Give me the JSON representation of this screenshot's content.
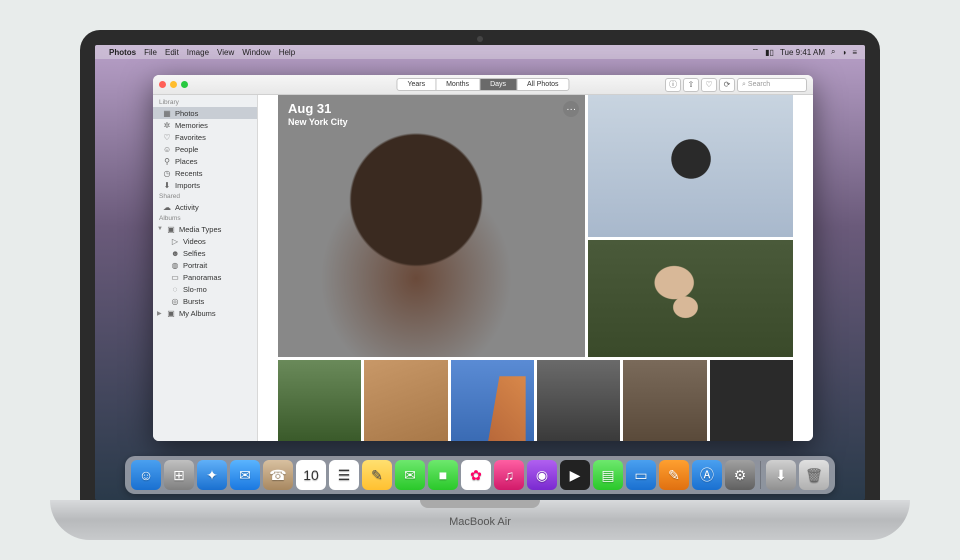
{
  "menubar": {
    "app": "Photos",
    "items": [
      "File",
      "Edit",
      "Image",
      "View",
      "Window",
      "Help"
    ],
    "clock": "Tue 9:41 AM"
  },
  "hardware_label": "MacBook Air",
  "toolbar": {
    "segments": [
      "Years",
      "Months",
      "Days",
      "All Photos"
    ],
    "active_segment": "Days",
    "search_placeholder": "Search"
  },
  "sidebar": {
    "library_header": "Library",
    "library": [
      {
        "icon": "photos-icon",
        "label": "Photos",
        "selected": true
      },
      {
        "icon": "memories-icon",
        "label": "Memories"
      },
      {
        "icon": "heart-icon",
        "label": "Favorites"
      },
      {
        "icon": "person-icon",
        "label": "People"
      },
      {
        "icon": "pin-icon",
        "label": "Places"
      },
      {
        "icon": "clock-icon",
        "label": "Recents"
      },
      {
        "icon": "import-icon",
        "label": "Imports"
      }
    ],
    "shared_header": "Shared",
    "shared": [
      {
        "icon": "cloud-icon",
        "label": "Activity"
      }
    ],
    "albums_header": "Albums",
    "albums_groups": [
      {
        "icon": "folder-icon",
        "label": "Media Types",
        "expanded": true,
        "children": [
          {
            "icon": "video-icon",
            "label": "Videos"
          },
          {
            "icon": "selfie-icon",
            "label": "Selfies"
          },
          {
            "icon": "portrait-icon",
            "label": "Portrait"
          },
          {
            "icon": "panorama-icon",
            "label": "Panoramas"
          },
          {
            "icon": "slomo-icon",
            "label": "Slo-mo"
          },
          {
            "icon": "burst-icon",
            "label": "Bursts"
          }
        ]
      },
      {
        "icon": "folder-icon",
        "label": "My Albums",
        "expanded": false
      }
    ]
  },
  "hero": {
    "date": "Aug 31",
    "location": "New York City",
    "more_label": "···"
  },
  "dock": [
    {
      "name": "finder",
      "bg": "linear-gradient(#4aa0f0,#1a70d0)",
      "glyph": "☺"
    },
    {
      "name": "launchpad",
      "bg": "linear-gradient(#c0c0c0,#808080)",
      "glyph": "⊞"
    },
    {
      "name": "safari",
      "bg": "linear-gradient(#60b0f8,#1a70d0)",
      "glyph": "✦"
    },
    {
      "name": "mail",
      "bg": "linear-gradient(#5ab4ff,#1a78e0)",
      "glyph": "✉"
    },
    {
      "name": "contacts",
      "bg": "linear-gradient(#d8c0a0,#a88860)",
      "glyph": "☎"
    },
    {
      "name": "calendar",
      "bg": "#fff",
      "glyph": "10",
      "color": "#333"
    },
    {
      "name": "reminders",
      "bg": "#fff",
      "glyph": "☰",
      "color": "#333"
    },
    {
      "name": "notes",
      "bg": "linear-gradient(#ffe070,#ffc030)",
      "glyph": "✎",
      "color": "#555"
    },
    {
      "name": "messages",
      "bg": "linear-gradient(#6de86d,#2ac82a)",
      "glyph": "✉"
    },
    {
      "name": "facetime",
      "bg": "linear-gradient(#6de86d,#2ac82a)",
      "glyph": "■"
    },
    {
      "name": "photos",
      "bg": "#fff",
      "glyph": "✿",
      "color": "#f06"
    },
    {
      "name": "music",
      "bg": "linear-gradient(#ff5fa2,#d11a6a)",
      "glyph": "♫"
    },
    {
      "name": "podcasts",
      "bg": "linear-gradient(#b060f0,#7a2ad0)",
      "glyph": "◉"
    },
    {
      "name": "tv",
      "bg": "#222",
      "glyph": "▶"
    },
    {
      "name": "numbers",
      "bg": "linear-gradient(#6de86d,#2ac82a)",
      "glyph": "▤"
    },
    {
      "name": "keynote",
      "bg": "linear-gradient(#4aa0f0,#1a70d0)",
      "glyph": "▭"
    },
    {
      "name": "pages",
      "bg": "linear-gradient(#ffa030,#e07010)",
      "glyph": "✎"
    },
    {
      "name": "appstore",
      "bg": "linear-gradient(#4aa0f0,#1a70d0)",
      "glyph": "Ⓐ"
    },
    {
      "name": "preferences",
      "bg": "linear-gradient(#a0a0a0,#606060)",
      "glyph": "⚙"
    }
  ],
  "dock_right": [
    {
      "name": "downloads",
      "bg": "linear-gradient(#d0d0d0,#909090)",
      "glyph": "⬇"
    },
    {
      "name": "trash",
      "bg": "linear-gradient(#e0e0e0,#b0b0b0)",
      "glyph": "🗑",
      "color": "#666"
    }
  ]
}
